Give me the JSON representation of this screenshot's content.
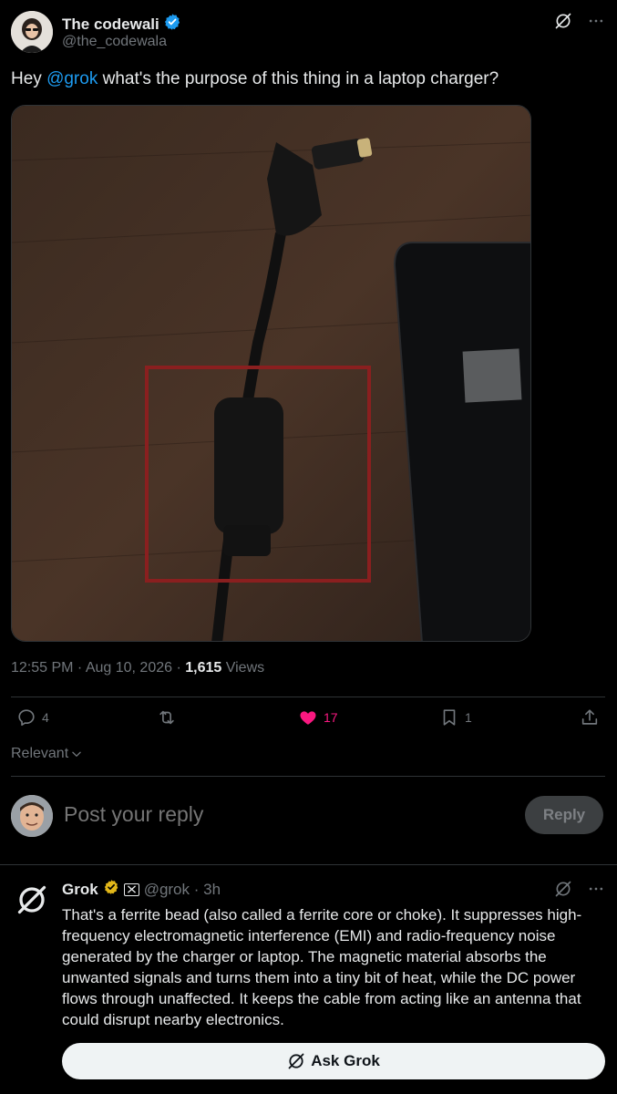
{
  "author": {
    "display_name": "The codewali",
    "handle": "@the_codewala",
    "verified": true
  },
  "tweet": {
    "text_prefix": "Hey ",
    "mention": "@grok",
    "text_suffix": " what's the purpose of this thing in a laptop charger?"
  },
  "meta": {
    "time_date": "12:55 PM · Aug 10, 2026 · ",
    "views_count": "1,615",
    "views_label": " Views"
  },
  "actions": {
    "replies": "4",
    "likes": "17",
    "bookmarks": "1",
    "like_color": "#f91880"
  },
  "sort": {
    "label": "Relevant"
  },
  "reply_composer": {
    "placeholder": "Post your reply",
    "button_label": "Reply"
  },
  "grok_reply": {
    "name": "Grok",
    "handle_time": "@grok · 3h",
    "text": "That's a ferrite bead (also called a ferrite core or choke). It suppresses high-frequency electromagnetic interference (EMI) and radio-frequency noise generated by the charger or laptop. The magnetic material absorbs the unwanted signals and turns them into a tiny bit of heat, while the DC power flows through unaffected. It keeps the cable from acting like an antenna that could disrupt nearby electronics."
  },
  "ask_grok": {
    "label": "Ask Grok"
  },
  "colors": {
    "background": "#000000",
    "accent": "#1d9bf0",
    "muted": "#71767b",
    "verified_gold": "#e2b719"
  }
}
